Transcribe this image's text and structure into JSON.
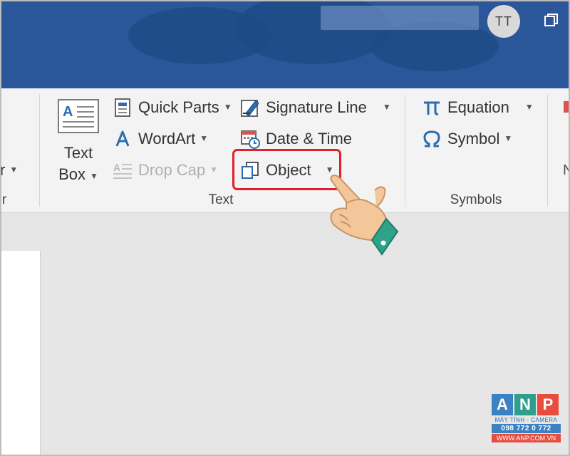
{
  "header": {
    "avatar_initials": "TT"
  },
  "ribbon": {
    "left_partial": {
      "label": "r",
      "group_label": "r"
    },
    "text_group": {
      "label": "Text",
      "text_box": {
        "line1": "Text",
        "line2": "Box"
      },
      "quick_parts": "Quick Parts",
      "wordart": "WordArt",
      "drop_cap": "Drop Cap",
      "signature_line": "Signature Line",
      "date_time": "Date & Time",
      "object": "Object"
    },
    "symbols_group": {
      "label": "Symbols",
      "equation": "Equation",
      "symbol": "Symbol"
    },
    "right_partial": {
      "label": "N"
    }
  },
  "watermark": {
    "letters": [
      "A",
      "N",
      "P"
    ],
    "letter_colors": [
      "#3b82c4",
      "#2f9e8f",
      "#e74c3c"
    ],
    "tagline": "MÁY TÍNH - CAMERA",
    "phone": "098 772 0 772",
    "site": "WWW.ANP.COM.VN"
  },
  "colors": {
    "title_bar": "#2b579a",
    "highlight": "#e0202a"
  },
  "icons": {
    "text_box": "text-box-icon",
    "quick_parts": "quick-parts-icon",
    "wordart": "wordart-icon",
    "drop_cap": "drop-cap-icon",
    "signature_line": "signature-line-icon",
    "date_time": "date-time-icon",
    "object": "object-icon",
    "equation": "pi-icon",
    "symbol": "omega-icon",
    "pointer": "pointing-hand-icon"
  }
}
